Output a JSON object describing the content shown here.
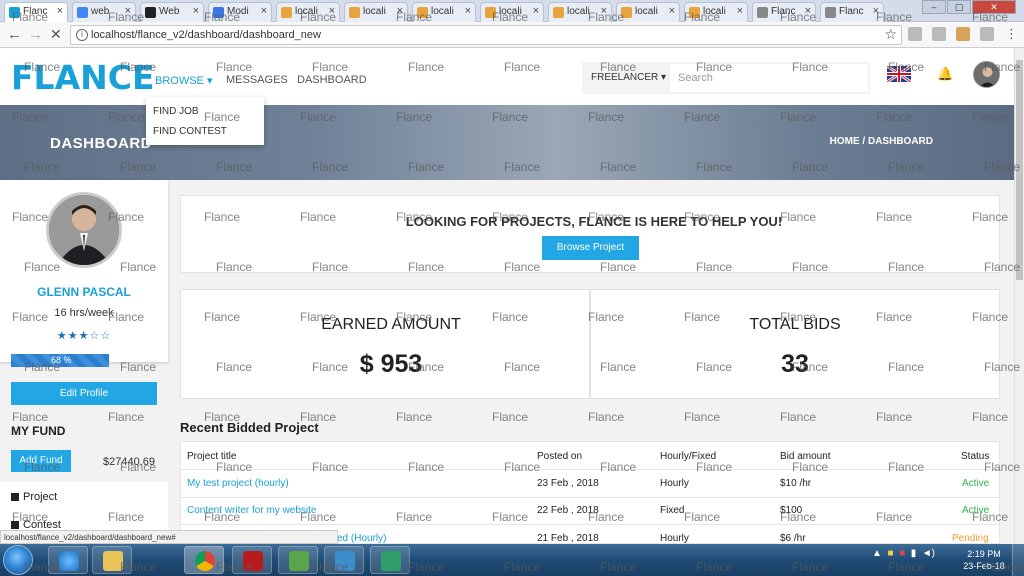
{
  "browser": {
    "tabs": [
      {
        "label": "Flanc",
        "active": true,
        "favicon_color": "#1aa0d8"
      },
      {
        "label": "web",
        "active": false,
        "favicon_color": "#4285f4"
      },
      {
        "label": "Web",
        "active": false,
        "favicon_color": "#222222"
      },
      {
        "label": "Modi",
        "active": false,
        "favicon_color": "#3b78e7"
      },
      {
        "label": "locali",
        "active": false,
        "favicon_color": "#e8a33d"
      },
      {
        "label": "locali",
        "active": false,
        "favicon_color": "#e8a33d"
      },
      {
        "label": "locali",
        "active": false,
        "favicon_color": "#e8a33d"
      },
      {
        "label": "locali",
        "active": false,
        "favicon_color": "#e8a33d"
      },
      {
        "label": "locali",
        "active": false,
        "favicon_color": "#e8a33d"
      },
      {
        "label": "locali",
        "active": false,
        "favicon_color": "#e8a33d"
      },
      {
        "label": "locali",
        "active": false,
        "favicon_color": "#e8a33d"
      },
      {
        "label": "Flanc",
        "active": false,
        "favicon_color": "#888888"
      },
      {
        "label": "Flanc",
        "active": false,
        "favicon_color": "#888888"
      }
    ],
    "tab_close_glyph": "×",
    "url": "localhost/flance_v2/dashboard/dashboard_new",
    "status_url": "localhost/flance_v2/dashboard/dashboard_new#"
  },
  "nav": {
    "logo": "FLANCE",
    "browse": "BROWSE ▾",
    "messages": "MESSAGES",
    "dashboard": "DASHBOARD",
    "browse_menu": [
      "FIND JOB",
      "FIND CONTEST"
    ],
    "freelancer": "FREELANCER ▾",
    "search_placeholder": "Search",
    "accent": "#1aa0d8"
  },
  "hero": {
    "title": "DASHBOARD",
    "breadcrumb": "HOME  /  DASHBOARD"
  },
  "profile": {
    "name": "GLENN PASCAL",
    "hours": "16 hrs/week",
    "stars": "★★★☆☆",
    "rating": 3,
    "progress_label": "68 %",
    "progress": 0.68,
    "edit_label": "Edit Profile"
  },
  "fund": {
    "title": "MY FUND",
    "add_label": "Add Fund",
    "amount": "$27440.69"
  },
  "sidebar": {
    "items": [
      "Project",
      "Contest"
    ]
  },
  "looking": {
    "text": "LOOKING FOR PROJECTS, FLANCE IS HERE TO HELP YOU!",
    "button": "Browse Project"
  },
  "stats": {
    "earned_label": "EARNED AMOUNT",
    "earned_value": "$ 953",
    "bids_label": "TOTAL BIDS",
    "bids_value": "33"
  },
  "recent": {
    "title": "Recent Bidded Project",
    "columns": [
      "Project title",
      "Posted on",
      "Hourly/Fixed",
      "Bid amount",
      "Status"
    ],
    "rows": [
      {
        "title": "My test project (hourly)",
        "posted": "23 Feb , 2018",
        "type": "Hourly",
        "bid": "$10 /hr",
        "status": "Active"
      },
      {
        "title": "Content writer for my website",
        "posted": "22 Feb , 2018",
        "type": "Fixed",
        "bid": "$100",
        "status": "Active"
      },
      {
        "title": "ed (Hourly)",
        "posted": "21 Feb , 2018",
        "type": "Hourly",
        "bid": "$6 /hr",
        "status": "Pending"
      }
    ]
  },
  "taskbar": {
    "time": "2:19 PM",
    "date": "23-Feb-18"
  },
  "watermark": "Flance"
}
